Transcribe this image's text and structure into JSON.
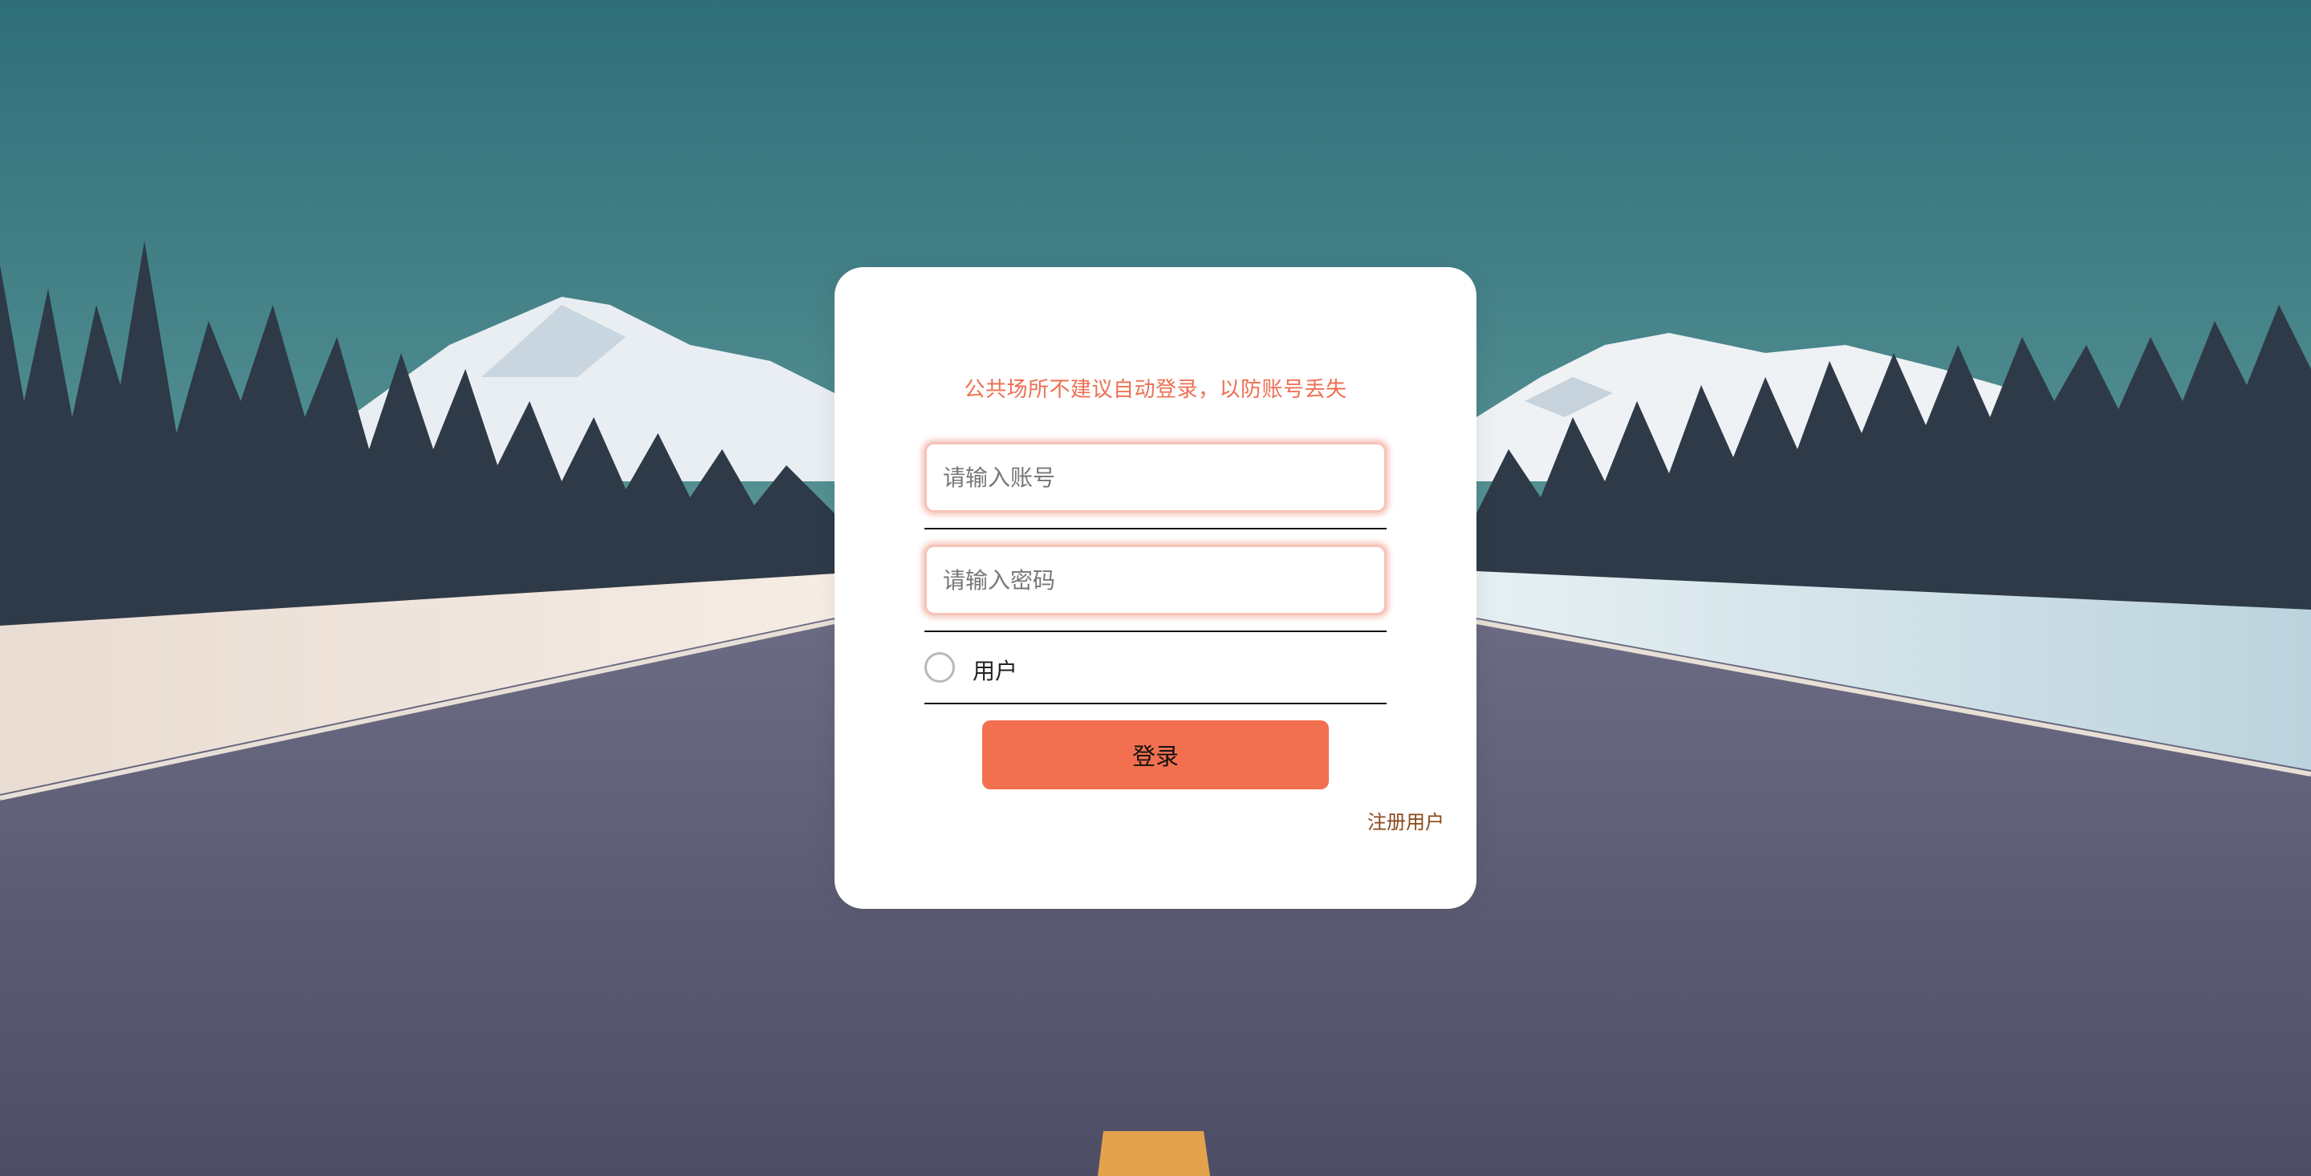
{
  "login": {
    "notice": "公共场所不建议自动登录，以防账号丢失",
    "account_placeholder": "请输入账号",
    "password_placeholder": "请输入密码",
    "role_label": "用户",
    "submit_label": "登录",
    "register_label": "注册用户"
  },
  "colors": {
    "accent": "#f2704f",
    "notice_text": "#ee6f52",
    "link_text": "#8a4a1c",
    "card_bg": "#ffffff"
  }
}
